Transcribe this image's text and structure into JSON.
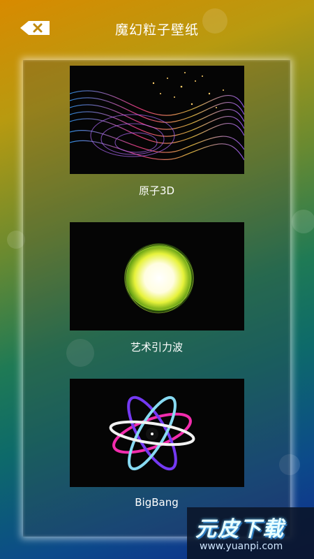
{
  "header": {
    "title": "魔幻粒子壁纸",
    "back_icon": "back-close-icon"
  },
  "wallpapers": [
    {
      "label": "原子3D",
      "preview": "particle-wave-preview"
    },
    {
      "label": "艺术引力波",
      "preview": "glowing-orb-preview"
    },
    {
      "label": "BigBang",
      "preview": "atom-orbit-preview"
    }
  ],
  "watermark": {
    "main": "元皮下载",
    "sub": "www.yuanpi.com"
  }
}
